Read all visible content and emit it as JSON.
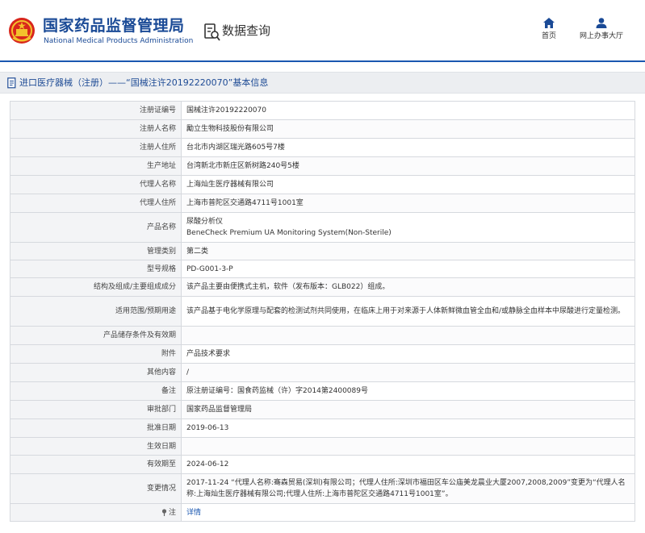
{
  "header": {
    "site_title_cn": "国家药品监督管理局",
    "site_title_en": "National Medical Products Administration",
    "query_title": "数据查询",
    "nav": [
      {
        "label": "首页",
        "icon": "home-icon"
      },
      {
        "label": "网上办事大厅",
        "icon": "user-icon"
      }
    ]
  },
  "breadcrumb": {
    "icon": "document-icon",
    "text": "进口医疗器械（注册）——“国械注许20192220070”基本信息"
  },
  "details": [
    {
      "label": "注册证编号",
      "value": "国械注许20192220070"
    },
    {
      "label": "注册人名称",
      "value": "勵立生物科技股份有限公司"
    },
    {
      "label": "注册人住所",
      "value": "台北市内湖区瑞光路605号7楼"
    },
    {
      "label": "生产地址",
      "value": "台湾新北市新庄区新树路240号5楼"
    },
    {
      "label": "代理人名称",
      "value": "上海灿生医疗器械有限公司"
    },
    {
      "label": "代理人住所",
      "value": "上海市普陀区交通路4711号1001室"
    },
    {
      "label": "产品名称",
      "value": "尿酸分析仪",
      "value2": "BeneCheck Premium UA Monitoring System(Non-Sterile)"
    },
    {
      "label": "管理类别",
      "value": "第二类"
    },
    {
      "label": "型号规格",
      "value": "PD-G001-3-P"
    },
    {
      "label": "结构及组成/主要组成成分",
      "value": "该产品主要由便携式主机，软件（发布版本：GLB022）组成。"
    },
    {
      "label": "适用范围/预期用途",
      "value": "该产品基于电化学原理与配套的检测试剂共同使用，在临床上用于对来源于人体新鲜微血管全血和/或静脉全血样本中尿酸进行定量检测。"
    },
    {
      "label": "产品储存条件及有效期",
      "value": ""
    },
    {
      "label": "附件",
      "value": "产品技术要求"
    },
    {
      "label": "其他内容",
      "value": "/"
    },
    {
      "label": "备注",
      "value": "原注册证编号：国食药监械（许）字2014第2400089号"
    },
    {
      "label": "审批部门",
      "value": "国家药品监督管理局"
    },
    {
      "label": "批准日期",
      "value": "2019-06-13"
    },
    {
      "label": "生效日期",
      "value": ""
    },
    {
      "label": "有效期至",
      "value": "2024-06-12"
    },
    {
      "label": "变更情况",
      "value": "2017-11-24 “代理人名称:骞森贸易(深圳)有限公司；代理人住所:深圳市福田区车公庙美龙晨业大厦2007,2008,2009”变更为“代理人名称:上海灿生医疗器械有限公司;代理人住所:上海市普陀区交通路4711号1001室”。"
    }
  ],
  "footer_row": {
    "label_icon": "pin-icon",
    "label": "注",
    "link": "详情"
  }
}
